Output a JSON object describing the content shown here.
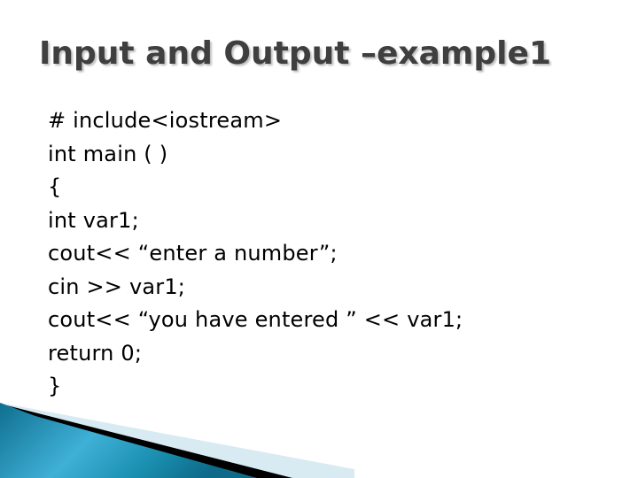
{
  "slide": {
    "title": "Input and Output –example1",
    "code_lines": [
      "# include<iostream>",
      "int main ( )",
      "{",
      "int var1;",
      "cout<< “enter a number”;",
      "cin >> var1;",
      "cout<< “you have entered ” << var1;",
      "return 0;",
      "}"
    ],
    "colors": {
      "title": "#3f3f3f",
      "accent_blue": "#1a8fb0",
      "accent_light": "#d8ebf2"
    }
  }
}
